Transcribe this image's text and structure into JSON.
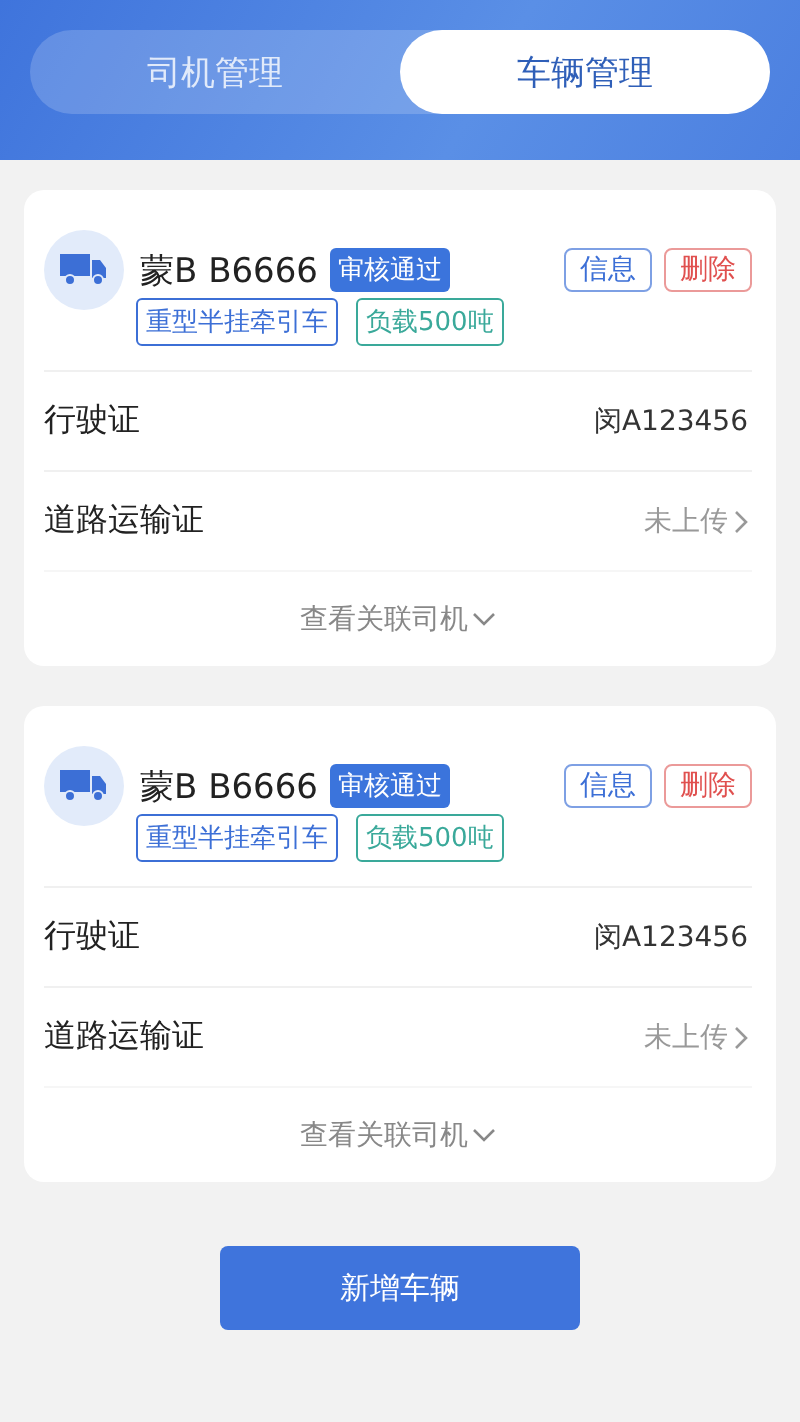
{
  "tabs": [
    {
      "label": "司机管理",
      "selected": false
    },
    {
      "label": "车辆管理",
      "selected": true
    }
  ],
  "vehicles": [
    {
      "plate": "蒙B B6666",
      "status": "审核通过",
      "actions": [
        {
          "label": "信息",
          "kind": "info"
        },
        {
          "label": "删除",
          "kind": "danger"
        }
      ],
      "tags": [
        {
          "label": "重型半挂牵引车",
          "color": "#3c6fd6"
        },
        {
          "label": "负载500吨",
          "color": "#3aa99a"
        }
      ],
      "rows": [
        {
          "label": "行驶证",
          "value": "闵A123456",
          "kind": "value"
        },
        {
          "label": "道路运输证",
          "value": "未上传",
          "kind": "link"
        }
      ],
      "footer": "查看关联司机"
    },
    {
      "plate": "蒙B B6666",
      "status": "审核通过",
      "actions": [
        {
          "label": "信息",
          "kind": "info"
        },
        {
          "label": "删除",
          "kind": "danger"
        }
      ],
      "tags": [
        {
          "label": "重型半挂牵引车",
          "color": "#3c6fd6"
        },
        {
          "label": "负载500吨",
          "color": "#3aa99a"
        }
      ],
      "rows": [
        {
          "label": "行驶证",
          "value": "闵A123456",
          "kind": "value"
        },
        {
          "label": "道路运输证",
          "value": "未上传",
          "kind": "link"
        }
      ],
      "footer": "查看关联司机"
    }
  ],
  "add_button": "新增车辆"
}
